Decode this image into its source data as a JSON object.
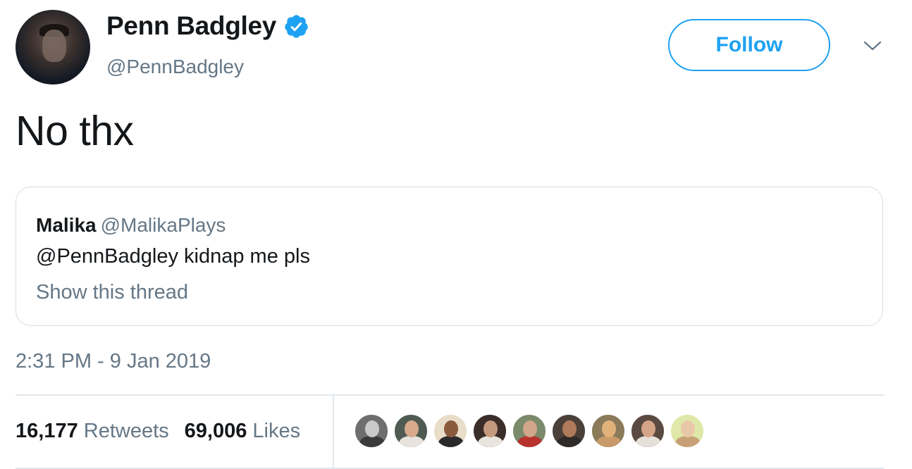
{
  "tweet": {
    "author_name": "Penn Badgley",
    "author_handle": "@PennBadgley",
    "verified_icon": "verified-badge-icon",
    "follow_label": "Follow",
    "menu_icon": "chevron-down-icon",
    "text": "No thx",
    "timestamp": "2:31 PM - 9 Jan 2019"
  },
  "quoted_tweet": {
    "author_name": "Malika",
    "author_handle": "@MalikaPlays",
    "text": "@PennBadgley kidnap me pls",
    "thread_link": "Show this thread"
  },
  "stats": {
    "retweets_count": "16,177",
    "retweets_label": "Retweets",
    "likes_count": "69,006",
    "likes_label": "Likes"
  },
  "likers": [
    {
      "bg": "#6e6e6e",
      "head": "#c9c9c9",
      "body": "#3a3a3a"
    },
    {
      "bg": "#4f5b52",
      "head": "#d9a98c",
      "body": "#e8e3dc"
    },
    {
      "bg": "#e8ddc8",
      "head": "#8a5a3c",
      "body": "#2a2a2a"
    },
    {
      "bg": "#3b2e2a",
      "head": "#c49a7e",
      "body": "#e9e4dd"
    },
    {
      "bg": "#7a8a6a",
      "head": "#d2a68a",
      "body": "#b8322e"
    },
    {
      "bg": "#4a4038",
      "head": "#b07a5a",
      "body": "#2e2a28"
    },
    {
      "bg": "#8a7a5a",
      "head": "#e0b27a",
      "body": "#c89a6a"
    },
    {
      "bg": "#5a4a42",
      "head": "#d6a488",
      "body": "#e6e0da"
    },
    {
      "bg": "#dfe8a8",
      "head": "#e8c8a8",
      "body": "#c8a078"
    }
  ],
  "colors": {
    "accent": "#1da1f2",
    "secondary_text": "#657786",
    "primary_text": "#14171a"
  }
}
